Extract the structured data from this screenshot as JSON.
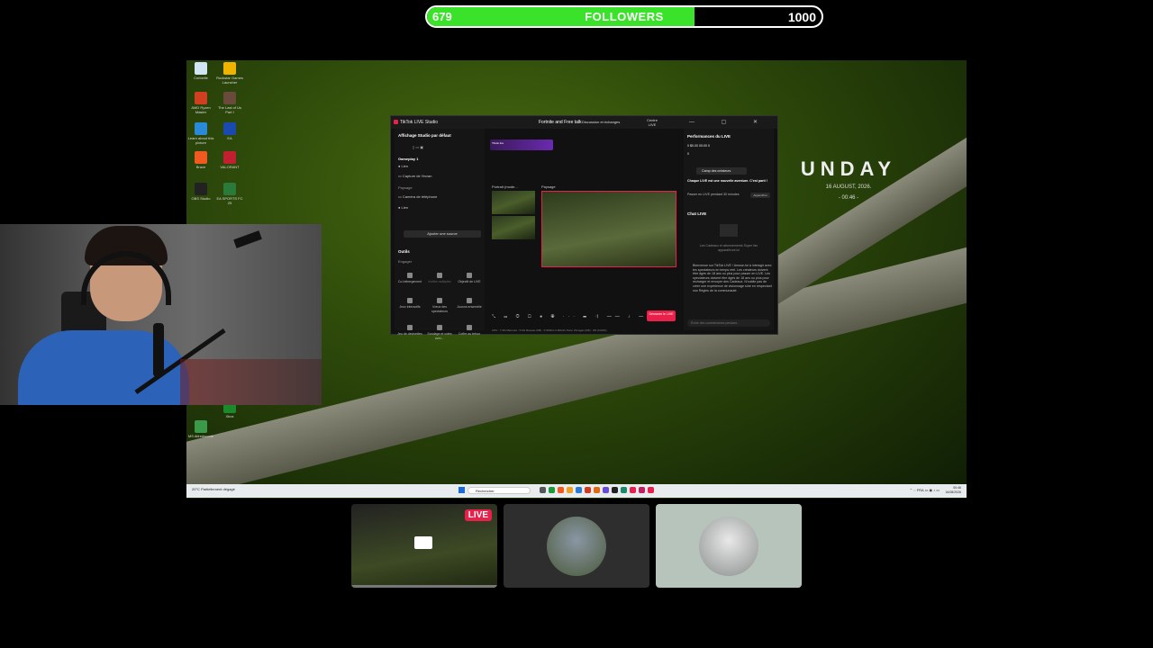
{
  "followers_bar": {
    "current": "679",
    "label": "FOLLOWERS",
    "goal": "1000",
    "progress": 0.679,
    "fill_color": "#3be22a"
  },
  "desktop": {
    "icons": [
      {
        "label": "Corbeille",
        "color": "#d0e4f4"
      },
      {
        "label": "Rockstar Games Launcher",
        "color": "#f0b400"
      },
      {
        "label": "AMD Ryzen Master",
        "color": "#d04020"
      },
      {
        "label": "The Last of Us Part I",
        "color": "#6a4a3a"
      },
      {
        "label": "Learn about this picture",
        "color": "#2a8ad8"
      },
      {
        "label": "EA",
        "color": "#1a4ab0"
      },
      {
        "label": "Brave",
        "color": "#f05a20"
      },
      {
        "label": "VALORANT",
        "color": "#c02030"
      },
      {
        "label": "OBS Studio",
        "color": "#222222"
      },
      {
        "label": "EA SPORTS FC 25",
        "color": "#2a7a3a"
      },
      {
        "label": "Xbox",
        "color": "#1a8a2a"
      },
      {
        "label": "MS Alfredscorte",
        "color": "#3a9a4a"
      }
    ],
    "clock": {
      "text": "UNDAY",
      "date": "16 AUGUST, 2026.",
      "time": "- 00:46 -"
    }
  },
  "taskbar": {
    "weather_temp": "20°C",
    "weather_desc": "Partiellement dégagé",
    "search_placeholder": "Rechercher",
    "tray_lang": "FRA",
    "clock_time": "00:46",
    "clock_date": "16/08/2026"
  },
  "tiktok": {
    "title": "TikTok LIVE Studio",
    "stream_title": "Fortnite and Free talk",
    "category": "Discussion et échanges",
    "centre_label": "Centre LIVE",
    "left": {
      "view_label": "Affichage Studio par défaut",
      "scene": "Gameplay 1",
      "sources": [
        "Lien",
        "Capture de l'écran"
      ],
      "section_paysage": "Paysage",
      "sources2": [
        "Caméra de téléphone",
        "Lien"
      ],
      "add_source": "Ajouter une source",
      "tools_title": "Outils",
      "engage": "Engager",
      "tools": [
        "Co-hébergement",
        "Invités multiples",
        "Objectif de LIVE",
        "Jeux interactifs",
        "Vœux des spectateurs",
        "Jouons ensemble",
        "Jeu de devinettes",
        "Sondage et votes avec...",
        "Coffre au trésor"
      ]
    },
    "mid": {
      "banner": "Tiktok live",
      "portrait_label": "Portrait (mode...",
      "landscape_label": "Paysage",
      "go_live": "Démarrer le LIVE",
      "status": "CPU : 7,3%    Mémoire : 5.9G    Réseau (KB) : 0.5Kbit/s 0.0Kbit/s    Perte d'images (KB) : 0/0 (0.00%)"
    },
    "right": {
      "performance_title": "Performances du LIVE",
      "stats": "0    $0.00    00:00    0",
      "stat2": "0",
      "camp_button": "Camp des créateurs",
      "camp_desc": "Chaque LIVE est une nouvelle aventure. C'est parti !",
      "paused_label": "Passer en LIVE pendant 30 minutes",
      "paused_tag": "Aujourd'hui",
      "chat_title": "Chat LIVE",
      "chat_empty": "Les Cadeaux et abonnements Super fan apparaîtront ici",
      "welcome": "Bienvenue sur TikTok LIVE ! Amuse-toi à interagir avec tes spectateurs en temps réel. Les créateurs doivent être âgés de 18 ans ou plus pour passer en LIVE. Les spectateurs doivent être âgés de 18 ans ou plus pour recharger et envoyer des Cadeaux. N'oublie pas de créer une expérience de visionnage sûre en respectant nos Règles de la communauté.",
      "chat_placeholder": "Écrire des commentaires pendant..."
    }
  },
  "bottom": {
    "live_badge": "LIVE"
  }
}
